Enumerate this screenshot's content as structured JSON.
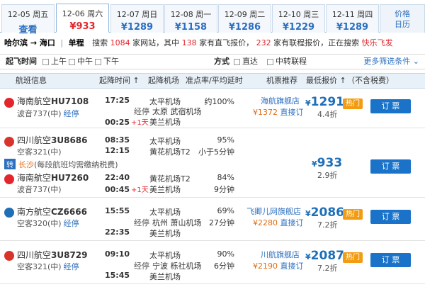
{
  "date_tabs": [
    {
      "date": "12-05 周五",
      "price": "查看"
    },
    {
      "date": "12-06 周六",
      "price": "¥933"
    },
    {
      "date": "12-07 周日",
      "price": "¥1289"
    },
    {
      "date": "12-08 周一",
      "price": "¥1158"
    },
    {
      "date": "12-09 周二",
      "price": "¥1286"
    },
    {
      "date": "12-10 周三",
      "price": "¥1229"
    },
    {
      "date": "12-11 周四",
      "price": "¥1289"
    }
  ],
  "calendar": {
    "line1": "价格",
    "line2": "日历"
  },
  "route": {
    "cities": "哈尔滨 → 海口",
    "sep": "|",
    "trip_type": "单程",
    "search_prefix": "搜索",
    "site_count": "1084",
    "site_suffix": "家网站，其中",
    "direct_count": "138",
    "direct_suffix": "家有直飞报价，",
    "transfer_count": "232",
    "transfer_suffix": "家有联程报价，正在搜索",
    "current_site": "快乐飞发"
  },
  "filter": {
    "time_label": "起飞时间",
    "time_options": [
      "上午",
      "中午",
      "下午"
    ],
    "mode_label": "方式",
    "mode_options": [
      "直达",
      "中转联程"
    ],
    "more": "更多筛选条件 ⌄"
  },
  "table_header": {
    "flight": "航班信息",
    "time": "起降时间 ↑",
    "airport": "起降机场",
    "ontime": "准点率/平均延时",
    "recommend": "机票推荐",
    "price": "最低报价 ↑",
    "tax": "（不含税费）"
  },
  "rows": [
    {
      "airline": "海南航空",
      "flight_no": "HU7108",
      "plane": "波音737(中)",
      "stop": "经停",
      "dep_time": "17:25",
      "arr_time": "00:25",
      "plus_day": "+1天",
      "dep_airport": "太平机场",
      "stop_label": "经停",
      "stop_city": "太原 武宿机场",
      "arr_airport": "美兰机场",
      "ontime": "约100%",
      "delay": "",
      "agent": "海航旗舰店",
      "agent_price": "¥1372",
      "agent_action": "直接订",
      "price": "1291",
      "discount": "4.4折",
      "hot": "热门",
      "book": "订 票"
    },
    {
      "airline": "四川航空",
      "flight_no": "3U8686",
      "plane": "空客321(中)",
      "stop": "",
      "dep_time": "08:35",
      "arr_time": "12:15",
      "dep_airport": "太平机场",
      "arr_airport": "黄花机场T2",
      "ontime": "95%",
      "delay": "小于5分钟"
    },
    {
      "airline": "海南航空",
      "flight_no": "HU7260",
      "plane": "波音737(中)",
      "stop": "",
      "dep_time": "22:40",
      "arr_time": "00:45",
      "plus_day": "+1天",
      "dep_airport": "黄花机场T2",
      "arr_airport": "美兰机场",
      "ontime": "84%",
      "delay": "9分钟"
    },
    {
      "airline": "南方航空",
      "flight_no": "CZ6666",
      "plane": "空客320(中)",
      "stop": "经停",
      "dep_time": "15:55",
      "arr_time": "22:35",
      "dep_airport": "太平机场",
      "stop_label": "经停",
      "stop_city": "杭州 萧山机场",
      "arr_airport": "美兰机场",
      "ontime": "69%",
      "delay": "27分钟",
      "agent": "飞卿儿网旗舰店",
      "agent_price": "¥2280",
      "agent_action": "直接订",
      "price": "2086",
      "discount": "7.2折",
      "hot": "热门",
      "book": "订 票"
    },
    {
      "airline": "四川航空",
      "flight_no": "3U8729",
      "plane": "空客321(中)",
      "stop": "经停",
      "dep_time": "09:10",
      "arr_time": "15:45",
      "dep_airport": "太平机场",
      "stop_label": "经停",
      "stop_city": "宁波 栎社机场",
      "arr_airport": "美兰机场",
      "ontime": "90%",
      "delay": "6分钟",
      "agent": "川航旗舰店",
      "agent_price": "¥2190",
      "agent_action": "直接订",
      "price": "2087",
      "discount": "7.2折",
      "hot": "热门",
      "book": "订 票"
    }
  ],
  "transfer": {
    "tag": "转",
    "city": "长沙",
    "note": "(每段航班均需缴纳税费)",
    "price": "933",
    "discount": "2.9折",
    "book": "订 票"
  },
  "colors": {
    "accent": "#2c6fc0",
    "price_red": "#e3262c",
    "book_button": "#1a73c8",
    "hot": "#f39c12"
  }
}
